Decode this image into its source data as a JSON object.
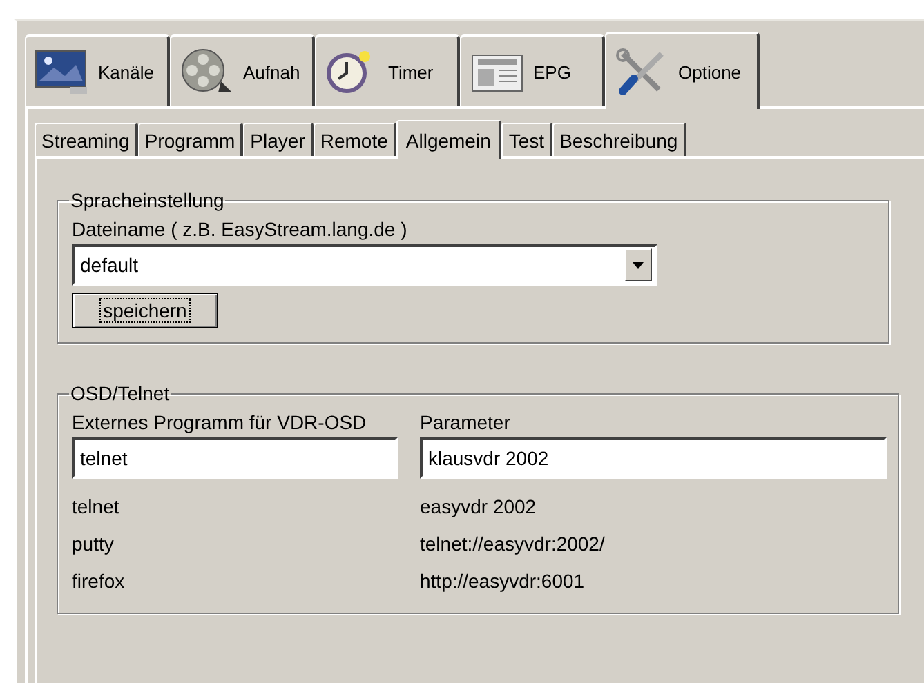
{
  "main_tabs": [
    {
      "label": "Kanäle",
      "selected": false
    },
    {
      "label": "Aufnah",
      "selected": false
    },
    {
      "label": "Timer",
      "selected": false
    },
    {
      "label": "EPG",
      "selected": false
    },
    {
      "label": "Optione",
      "selected": true
    }
  ],
  "sub_tabs": [
    {
      "label": "Streaming",
      "selected": false
    },
    {
      "label": "Programm",
      "selected": false
    },
    {
      "label": "Player",
      "selected": false
    },
    {
      "label": "Remote",
      "selected": false
    },
    {
      "label": "Allgemein",
      "selected": true
    },
    {
      "label": "Test",
      "selected": false
    },
    {
      "label": "Beschreibung",
      "selected": false
    }
  ],
  "language_group": {
    "title": "Spracheinstellung",
    "file_label": "Dateiname ( z.B. EasyStream.lang.de )",
    "file_value": "default",
    "save_button": "speichern"
  },
  "osd_group": {
    "title": "OSD/Telnet",
    "program_label": "Externes Programm für VDR-OSD",
    "parameter_label": "Parameter",
    "program_value": "telnet",
    "parameter_value": "klausvdr 2002",
    "examples": [
      {
        "program": "telnet",
        "parameter": "easyvdr 2002"
      },
      {
        "program": "putty",
        "parameter": "telnet://easyvdr:2002/"
      },
      {
        "program": "firefox",
        "parameter": "http://easyvdr:6001"
      }
    ]
  }
}
